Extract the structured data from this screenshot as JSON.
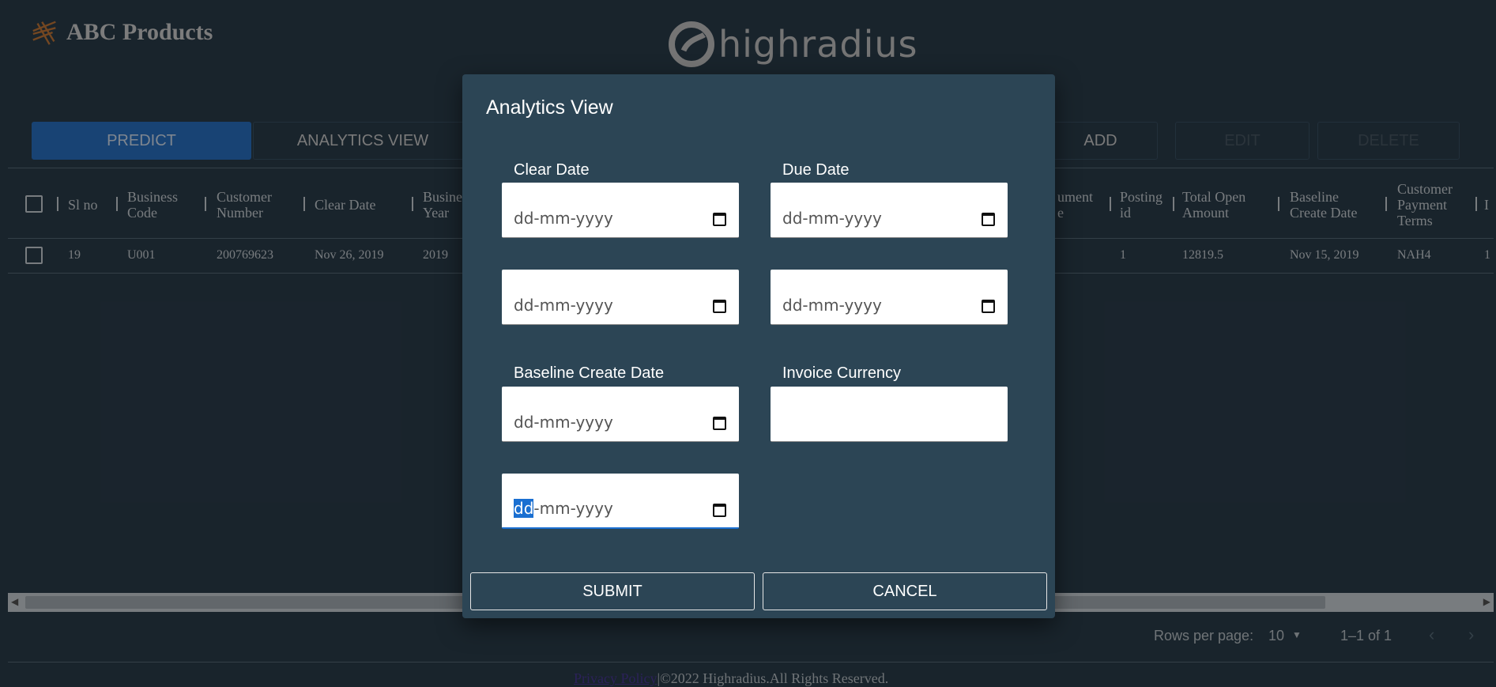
{
  "brand": {
    "name": "ABC Products"
  },
  "hr_logo": {
    "text": "highradius"
  },
  "toolbar": {
    "predict": "PREDICT",
    "analytics": "ANALYTICS VIEW",
    "add": "ADD",
    "edit": "EDIT",
    "delete": "DELETE"
  },
  "table": {
    "headers": {
      "sl_no": "Sl no",
      "business_code": [
        "Business",
        "Code"
      ],
      "customer_number": [
        "Customer",
        "Number"
      ],
      "clear_date": "Clear Date",
      "business_year": [
        "Busine",
        "Year"
      ],
      "document_type": [
        "ument",
        "e"
      ],
      "posting_id": [
        "Posting",
        "id"
      ],
      "total_open_amount": [
        "Total Open",
        "Amount"
      ],
      "baseline_create_date": [
        "Baseline",
        "Create Date"
      ],
      "customer_payment_terms": [
        "Customer",
        "Payment",
        "Terms"
      ],
      "cut": "I"
    },
    "row": {
      "sl_no": "19",
      "business_code": "U001",
      "customer_number": "200769623",
      "clear_date": "Nov 26, 2019",
      "business_year": "2019",
      "posting_id": "1",
      "total_open_amount": "12819.5",
      "baseline_create_date": "Nov 15, 2019",
      "customer_payment_terms": "NAH4",
      "cut": "1"
    }
  },
  "pagination": {
    "rows_per_page_label": "Rows per page:",
    "rows_per_page_value": "10",
    "range": "1–1 of 1"
  },
  "footer": {
    "link": "Privacy Policy",
    "text": "|©2022 Highradius.All Rights Reserved."
  },
  "modal": {
    "title": "Analytics View",
    "labels": {
      "clear_date": "Clear Date",
      "due_date": "Due Date",
      "baseline_create_date": "Baseline Create Date",
      "invoice_currency": "Invoice Currency"
    },
    "date_placeholder": "dd-mm-yyyy",
    "focused_placeholder_sel": "dd",
    "focused_placeholder_rest": "-mm-yyyy",
    "submit": "SUBMIT",
    "cancel": "CANCEL"
  }
}
